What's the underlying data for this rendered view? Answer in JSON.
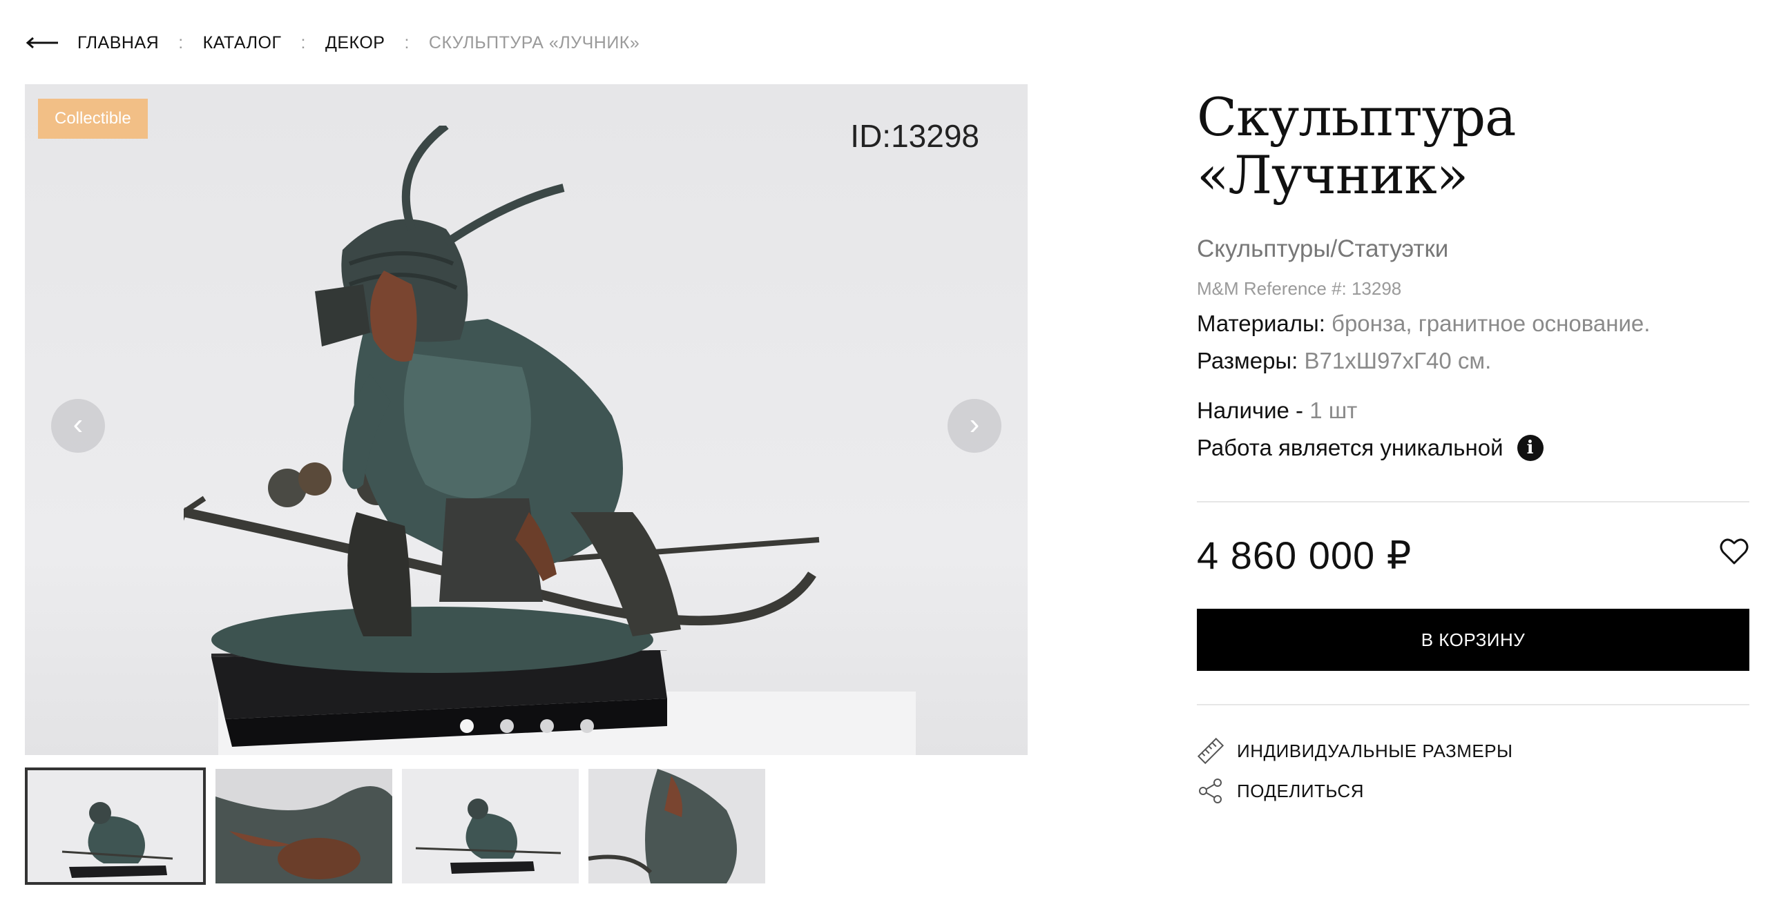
{
  "breadcrumb": {
    "items": [
      "ГЛАВНАЯ",
      "КАТАЛОГ",
      "ДЕКОР"
    ],
    "current": "СКУЛЬПТУРА «ЛУЧНИК»",
    "separator": ":"
  },
  "gallery": {
    "badge": "Collectible",
    "item_id": "ID:13298",
    "prev_label": "‹",
    "next_label": "›",
    "dots_count": 4,
    "active_dot": 0,
    "thumbnails_count": 4,
    "active_thumbnail": 0
  },
  "product": {
    "title": "Скульптура «Лучник»",
    "category": "Скульптуры/Статуэтки",
    "reference": "M&M Reference #: 13298",
    "materials_label": "Материалы:",
    "materials_value": "бронза, гранитное основание.",
    "size_label": "Размеры:",
    "size_value": "В71хШ97хГ40 см.",
    "availability_label": "Наличие -",
    "availability_value": "1 шт",
    "unique_text": "Работа является уникальной",
    "price": "4 860 000 ₽",
    "cart_button": "В КОРЗИНУ",
    "custom_sizes": "ИНДИВИДУАЛЬНЫЕ РАЗМЕРЫ",
    "share": "ПОДЕЛИТЬСЯ"
  },
  "colors": {
    "badge": "#f2bf86",
    "cart_button": "#000000",
    "muted_text": "#8a8a8a"
  }
}
